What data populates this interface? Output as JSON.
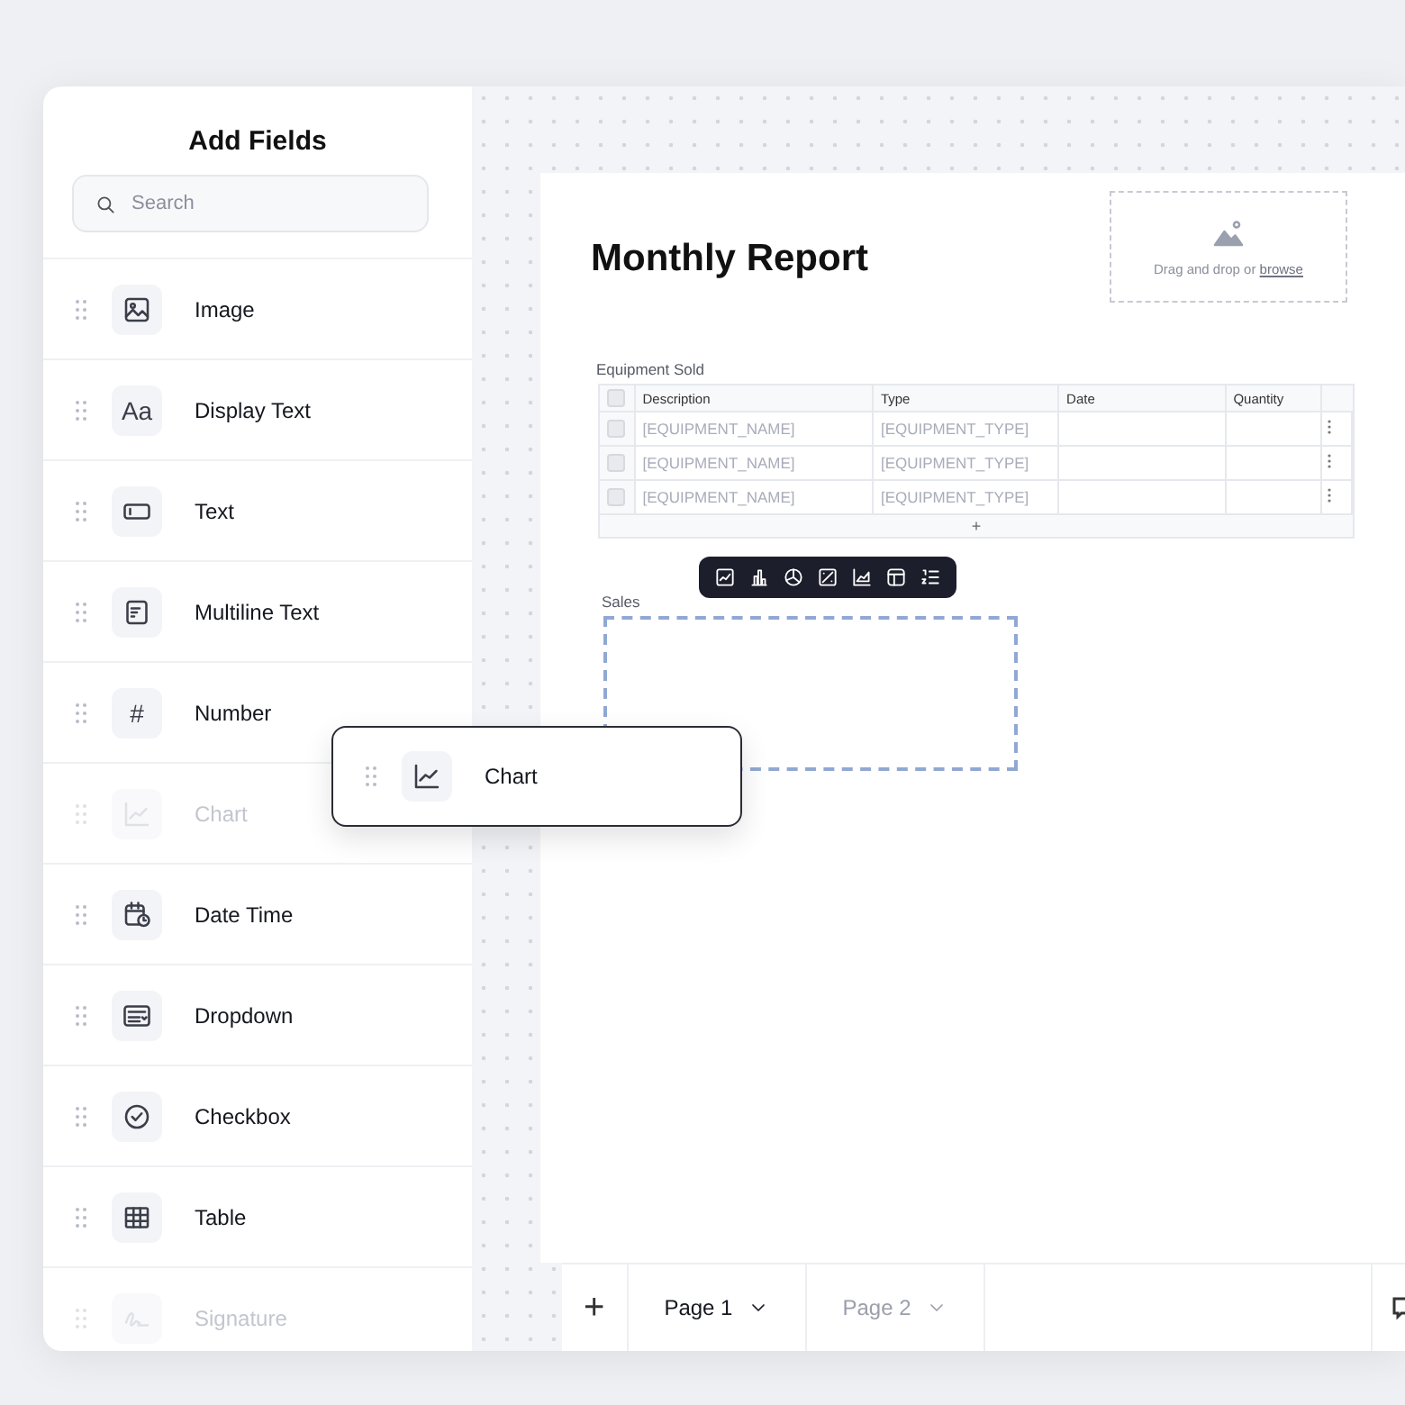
{
  "sidebar": {
    "title": "Add Fields",
    "search": {
      "placeholder": "Search"
    },
    "items": [
      {
        "label": "Image",
        "kind": "image",
        "dimmed": false
      },
      {
        "label": "Display Text",
        "kind": "glyph",
        "glyph": "Aa",
        "dimmed": false
      },
      {
        "label": "Text",
        "kind": "text",
        "dimmed": false
      },
      {
        "label": "Multiline Text",
        "kind": "multiline",
        "dimmed": false
      },
      {
        "label": "Number",
        "kind": "glyph",
        "glyph": "#",
        "dimmed": false
      },
      {
        "label": "Chart",
        "kind": "chart",
        "dimmed": true
      },
      {
        "label": "Date Time",
        "kind": "datetime",
        "dimmed": false
      },
      {
        "label": "Dropdown",
        "kind": "dropdown",
        "dimmed": false
      },
      {
        "label": "Checkbox",
        "kind": "checkbox",
        "dimmed": false
      },
      {
        "label": "Table",
        "kind": "table",
        "dimmed": false
      },
      {
        "label": "Signature",
        "kind": "signature",
        "dimmed": true
      }
    ]
  },
  "drag_card": {
    "label": "Chart",
    "kind": "chart"
  },
  "report": {
    "title": "Monthly Report",
    "upload": {
      "text": "Drag and drop or",
      "link": "browse"
    },
    "table": {
      "title": "Equipment Sold",
      "select_all_checked": false,
      "columns": [
        "Description",
        "Type",
        "Date",
        "Quantity"
      ],
      "rows": [
        {
          "checked": false,
          "cells": [
            "[EQUIPMENT_NAME]",
            "[EQUIPMENT_TYPE]"
          ]
        },
        {
          "checked": false,
          "cells": [
            "[EQUIPMENT_NAME]",
            "[EQUIPMENT_TYPE]"
          ]
        },
        {
          "checked": false,
          "cells": [
            "[EQUIPMENT_NAME]",
            "[EQUIPMENT_TYPE]"
          ]
        }
      ],
      "add_row": "+"
    },
    "chart_field": {
      "label": "Sales",
      "toolbar": [
        {
          "kind": "line"
        },
        {
          "kind": "bar"
        },
        {
          "kind": "pie"
        },
        {
          "kind": "scatter"
        },
        {
          "kind": "area"
        },
        {
          "kind": "table"
        },
        {
          "kind": "list"
        }
      ]
    }
  },
  "pages": {
    "add": "+",
    "tabs": [
      {
        "label": "Page 1",
        "selected": true
      },
      {
        "label": "Page 2",
        "selected": false
      }
    ]
  }
}
